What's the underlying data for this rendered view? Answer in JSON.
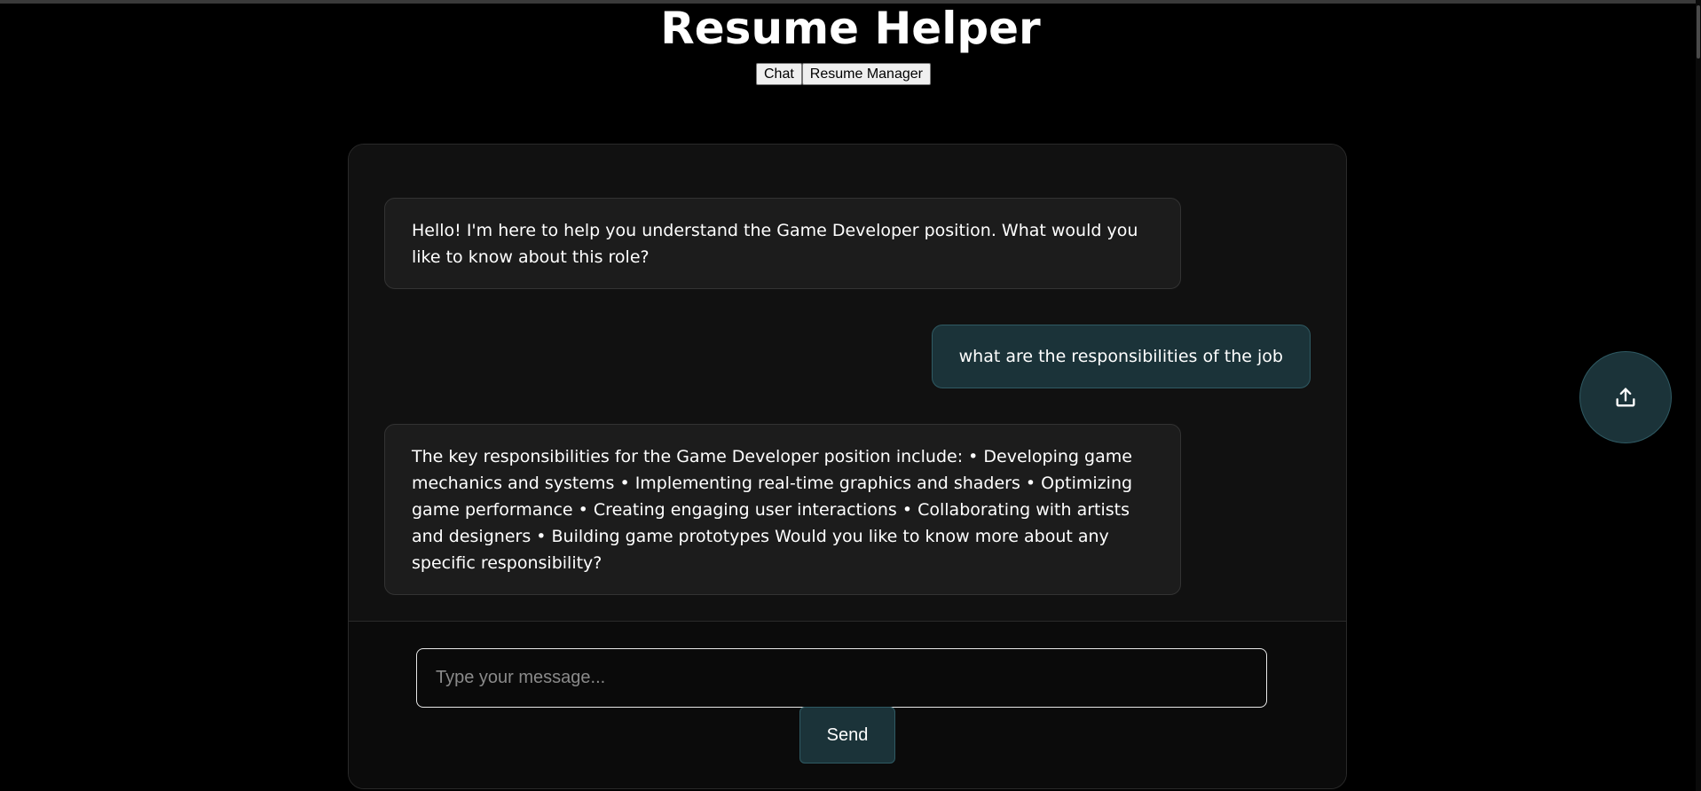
{
  "app": {
    "title": "Resume Helper"
  },
  "nav": {
    "chat_label": "Chat",
    "resume_manager_label": "Resume Manager"
  },
  "messages": [
    {
      "role": "bot",
      "text": "Hello! I'm here to help you understand the Game Developer position. What would you like to know about this role?"
    },
    {
      "role": "user",
      "text": "what are the responsibilities of the job"
    },
    {
      "role": "bot",
      "text": "The key responsibilities for the Game Developer position include: • Developing game mechanics and systems • Implementing real-time graphics and shaders • Optimizing game performance • Creating engaging user interactions • Collaborating with artists and designers • Building game prototypes Would you like to know more about any specific responsibility?"
    }
  ],
  "composer": {
    "placeholder": "Type your message...",
    "value": "",
    "send_label": "Send"
  },
  "upload": {
    "icon": "upload-icon"
  },
  "colors": {
    "background": "#000000",
    "panel": "#0f0f0f",
    "bot_bubble": "#1c1c1c",
    "user_bubble": "#1b3339",
    "accent_border": "#2f5a63",
    "text": "#ffffff"
  }
}
